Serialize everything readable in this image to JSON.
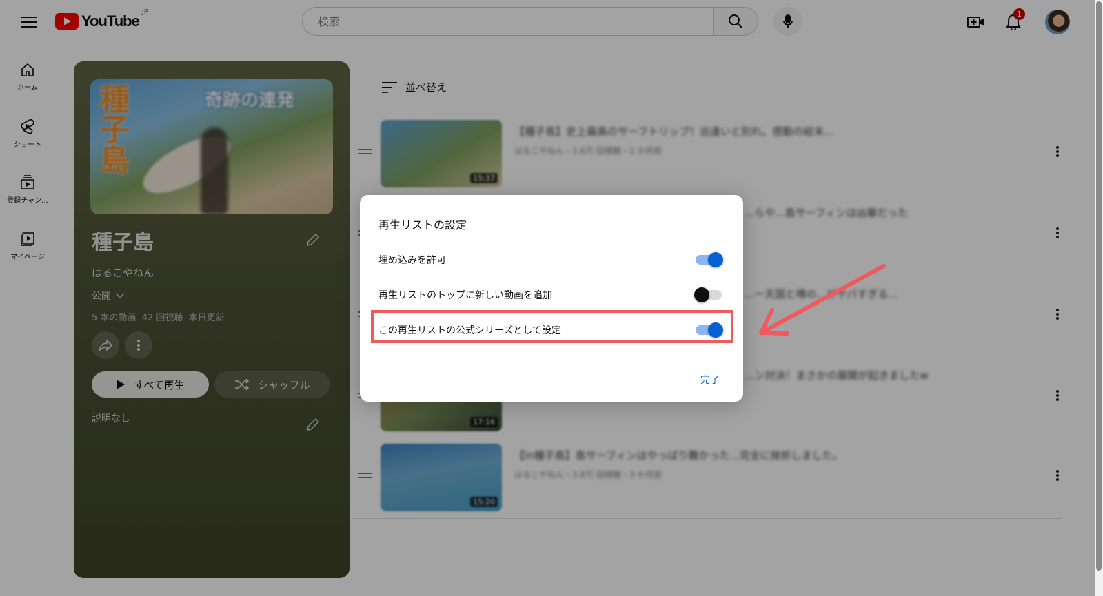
{
  "masthead": {
    "logo_text": "YouTube",
    "region": "JP",
    "search_placeholder": "検索",
    "notification_count": "1"
  },
  "nav": [
    {
      "label": "ホーム",
      "icon": "home-icon"
    },
    {
      "label": "ショート",
      "icon": "shorts-icon"
    },
    {
      "label": "登録チャン...",
      "icon": "subscriptions-icon"
    },
    {
      "label": "マイページ",
      "icon": "library-icon"
    }
  ],
  "playlist": {
    "title": "種子島",
    "owner": "はるこやねん",
    "privacy": "公開",
    "stats": "5 本の動画  42 回視聴  本日更新",
    "play_all": "すべて再生",
    "shuffle": "シャッフル",
    "description": "説明なし",
    "thumb_text_vertical": "種子島",
    "thumb_text_top": "奇跡の連発"
  },
  "list": {
    "sort_label": "並べ替え",
    "videos": [
      {
        "title": "【種子島】史上最高のサーフトリップ！出逢いと別れ。感動の結末...",
        "meta": "はるこやねん・1.6万 回視聴・1 か月前",
        "duration": "15:37"
      },
      {
        "title": "...らや...島サーフィンは凶暴だった",
        "meta": "",
        "duration": ""
      },
      {
        "title": "...ー天国と噂の...がヤバすぎる...",
        "meta": "",
        "duration": ""
      },
      {
        "title": "...ン対決！まさかの展開が起きましたw",
        "meta": "",
        "duration": "17:16"
      },
      {
        "title": "【in種子島】島サーフィンはやっぱり難かった...完全に挫折しました。",
        "meta": "はるこやねん・3.8万 回視聴・3 か月前",
        "duration": "15:20"
      }
    ]
  },
  "dialog": {
    "title": "再生リストの設定",
    "settings": [
      {
        "label": "埋め込みを許可",
        "enabled": true
      },
      {
        "label": "再生リストのトップに新しい動画を追加",
        "enabled": false
      },
      {
        "label": "この再生リストの公式シリーズとして設定",
        "enabled": true
      }
    ],
    "done": "完了"
  },
  "colors": {
    "accent": "#065fd4",
    "annotation": "#ef5a5e",
    "brand_red": "#ff0000"
  }
}
